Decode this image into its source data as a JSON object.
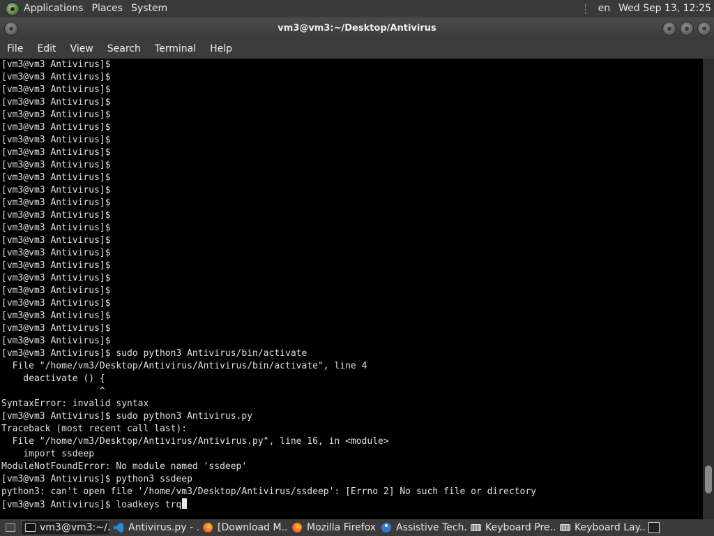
{
  "top_panel": {
    "menus": [
      "Applications",
      "Places",
      "System"
    ],
    "language": "en",
    "datetime": "Wed Sep 13, 12:25"
  },
  "window": {
    "title": "vm3@vm3:~/Desktop/Antivirus"
  },
  "menubar": [
    "File",
    "Edit",
    "View",
    "Search",
    "Terminal",
    "Help"
  ],
  "terminal": {
    "lines": [
      "[vm3@vm3 Antivirus]$",
      "[vm3@vm3 Antivirus]$",
      "[vm3@vm3 Antivirus]$",
      "[vm3@vm3 Antivirus]$",
      "[vm3@vm3 Antivirus]$",
      "[vm3@vm3 Antivirus]$",
      "[vm3@vm3 Antivirus]$",
      "[vm3@vm3 Antivirus]$",
      "[vm3@vm3 Antivirus]$",
      "[vm3@vm3 Antivirus]$",
      "[vm3@vm3 Antivirus]$",
      "[vm3@vm3 Antivirus]$",
      "[vm3@vm3 Antivirus]$",
      "[vm3@vm3 Antivirus]$",
      "[vm3@vm3 Antivirus]$",
      "[vm3@vm3 Antivirus]$",
      "[vm3@vm3 Antivirus]$",
      "[vm3@vm3 Antivirus]$",
      "[vm3@vm3 Antivirus]$",
      "[vm3@vm3 Antivirus]$",
      "[vm3@vm3 Antivirus]$",
      "[vm3@vm3 Antivirus]$",
      "[vm3@vm3 Antivirus]$",
      "[vm3@vm3 Antivirus]$ sudo python3 Antivirus/bin/activate",
      "  File \"/home/vm3/Desktop/Antivirus/Antivirus/bin/activate\", line 4",
      "    deactivate () {",
      "                  ^",
      "SyntaxError: invalid syntax",
      "[vm3@vm3 Antivirus]$ sudo python3 Antivirus.py",
      "Traceback (most recent call last):",
      "  File \"/home/vm3/Desktop/Antivirus/Antivirus.py\", line 16, in <module>",
      "    import ssdeep",
      "ModuleNotFoundError: No module named 'ssdeep'",
      "[vm3@vm3 Antivirus]$ python3 ssdeep",
      "python3: can't open file '/home/vm3/Desktop/Antivirus/ssdeep': [Errno 2] No such file or directory",
      "[vm3@vm3 Antivirus]$ loadkeys trq"
    ],
    "scroll_position_fraction": 0.94,
    "scroll_thumb_fraction": 0.06
  },
  "taskbar": {
    "tasks": [
      {
        "label": "vm3@vm3:~/...",
        "icon": "terminal-icon",
        "active": true
      },
      {
        "label": "Antivirus.py - ...",
        "icon": "vscode-icon",
        "active": false
      },
      {
        "label": "[Download M...",
        "icon": "firefox-icon",
        "active": false
      },
      {
        "label": "Mozilla Firefox",
        "icon": "firefox-icon",
        "active": false
      },
      {
        "label": "Assistive Tech...",
        "icon": "accessibility-icon",
        "active": false
      },
      {
        "label": "Keyboard Pre...",
        "icon": "keyboard-icon",
        "active": false
      },
      {
        "label": "Keyboard Lay...",
        "icon": "keyboard-icon",
        "active": false
      }
    ]
  }
}
